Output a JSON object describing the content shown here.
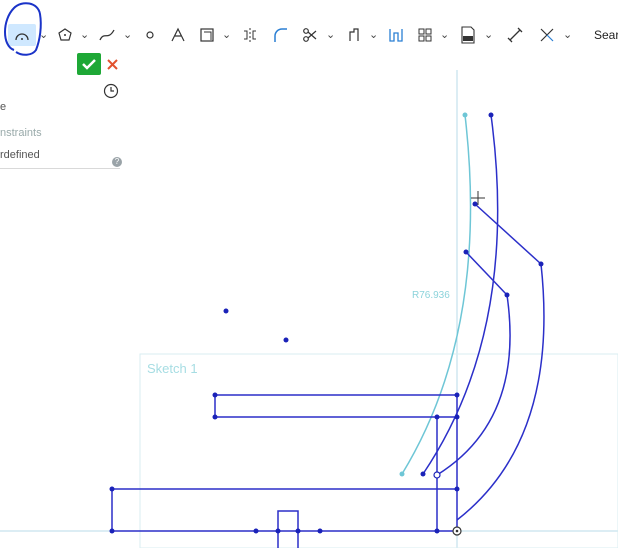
{
  "toolbar": {
    "items": [
      {
        "name": "arc-tool-icon",
        "active": true
      },
      {
        "name": "polygon-tool-icon"
      },
      {
        "name": "spline-tool-icon"
      },
      {
        "name": "point-tool-icon"
      },
      {
        "name": "text-tool-icon"
      },
      {
        "name": "offset-tool-icon"
      },
      {
        "name": "mirror-tool-icon"
      },
      {
        "name": "fillet-tool-icon"
      },
      {
        "name": "trim-tool-icon"
      },
      {
        "name": "transform-tool-icon"
      },
      {
        "name": "use-tool-icon"
      },
      {
        "name": "pattern-tool-icon"
      },
      {
        "name": "dxf-import-icon"
      },
      {
        "name": "dimension-tool-icon"
      },
      {
        "name": "construction-tool-icon"
      }
    ],
    "search_label": "Searc"
  },
  "dialog": {
    "ok_icon": "checkmark-icon",
    "cancel_icon": "close-icon",
    "history_icon": "clock-icon"
  },
  "panel": {
    "row1": "e",
    "row2": "nstraints",
    "row3": "rdefined",
    "help": "?"
  },
  "canvas": {
    "sketch_label": "Sketch 1",
    "dimension_label": "R76.936"
  },
  "colors": {
    "sketch_line": "#2b2fc9",
    "preview_line": "#6ec6d6",
    "accent": "#cfe8ff",
    "ok": "#1ea836",
    "cancel": "#e2522e",
    "annotation": "#1a33c8"
  }
}
